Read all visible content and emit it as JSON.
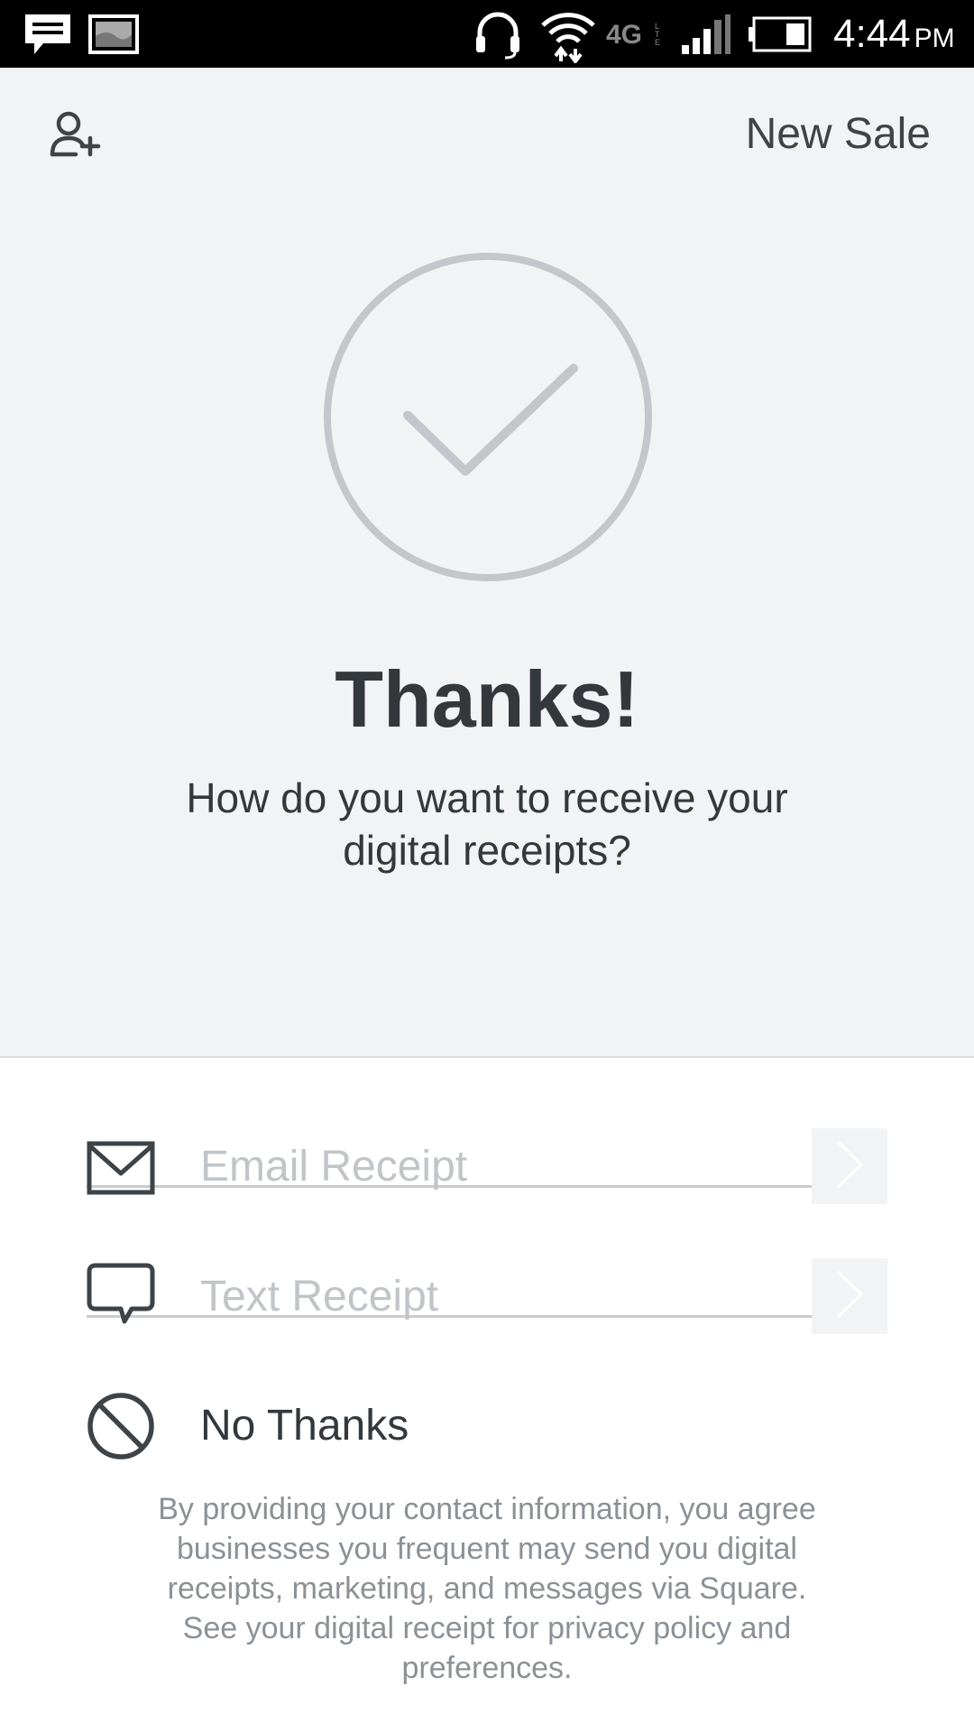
{
  "status_bar": {
    "time": "4:44",
    "ampm": "PM",
    "network": "4G",
    "icons": [
      "message-icon",
      "image-icon",
      "headset-icon",
      "wifi-icon",
      "lte-4g-icon",
      "signal-icon",
      "battery-icon"
    ]
  },
  "header": {
    "add_customer_icon": "person-add-icon",
    "new_sale_label": "New Sale"
  },
  "confirmation": {
    "icon": "checkmark-circle-icon",
    "title": "Thanks!",
    "subtitle": "How do you want to receive your digital receipts?"
  },
  "receipt_options": {
    "email": {
      "icon": "envelope-icon",
      "placeholder": "Email Receipt",
      "value": ""
    },
    "text": {
      "icon": "chat-bubble-icon",
      "placeholder": "Text Receipt",
      "value": ""
    },
    "no_thanks": {
      "icon": "prohibited-icon",
      "label": "No Thanks"
    }
  },
  "disclaimer": "By providing your contact information, you agree businesses you frequent may send you digital receipts, marketing, and messages via Square. See your digital receipt for privacy policy and preferences.",
  "colors": {
    "status_bar_bg": "#000000",
    "top_bg": "#f2f3f5",
    "text_dark": "#33383d",
    "placeholder": "#c1c5c9",
    "icon_gray": "#c3c7cb",
    "disclaimer": "#8b9196"
  }
}
